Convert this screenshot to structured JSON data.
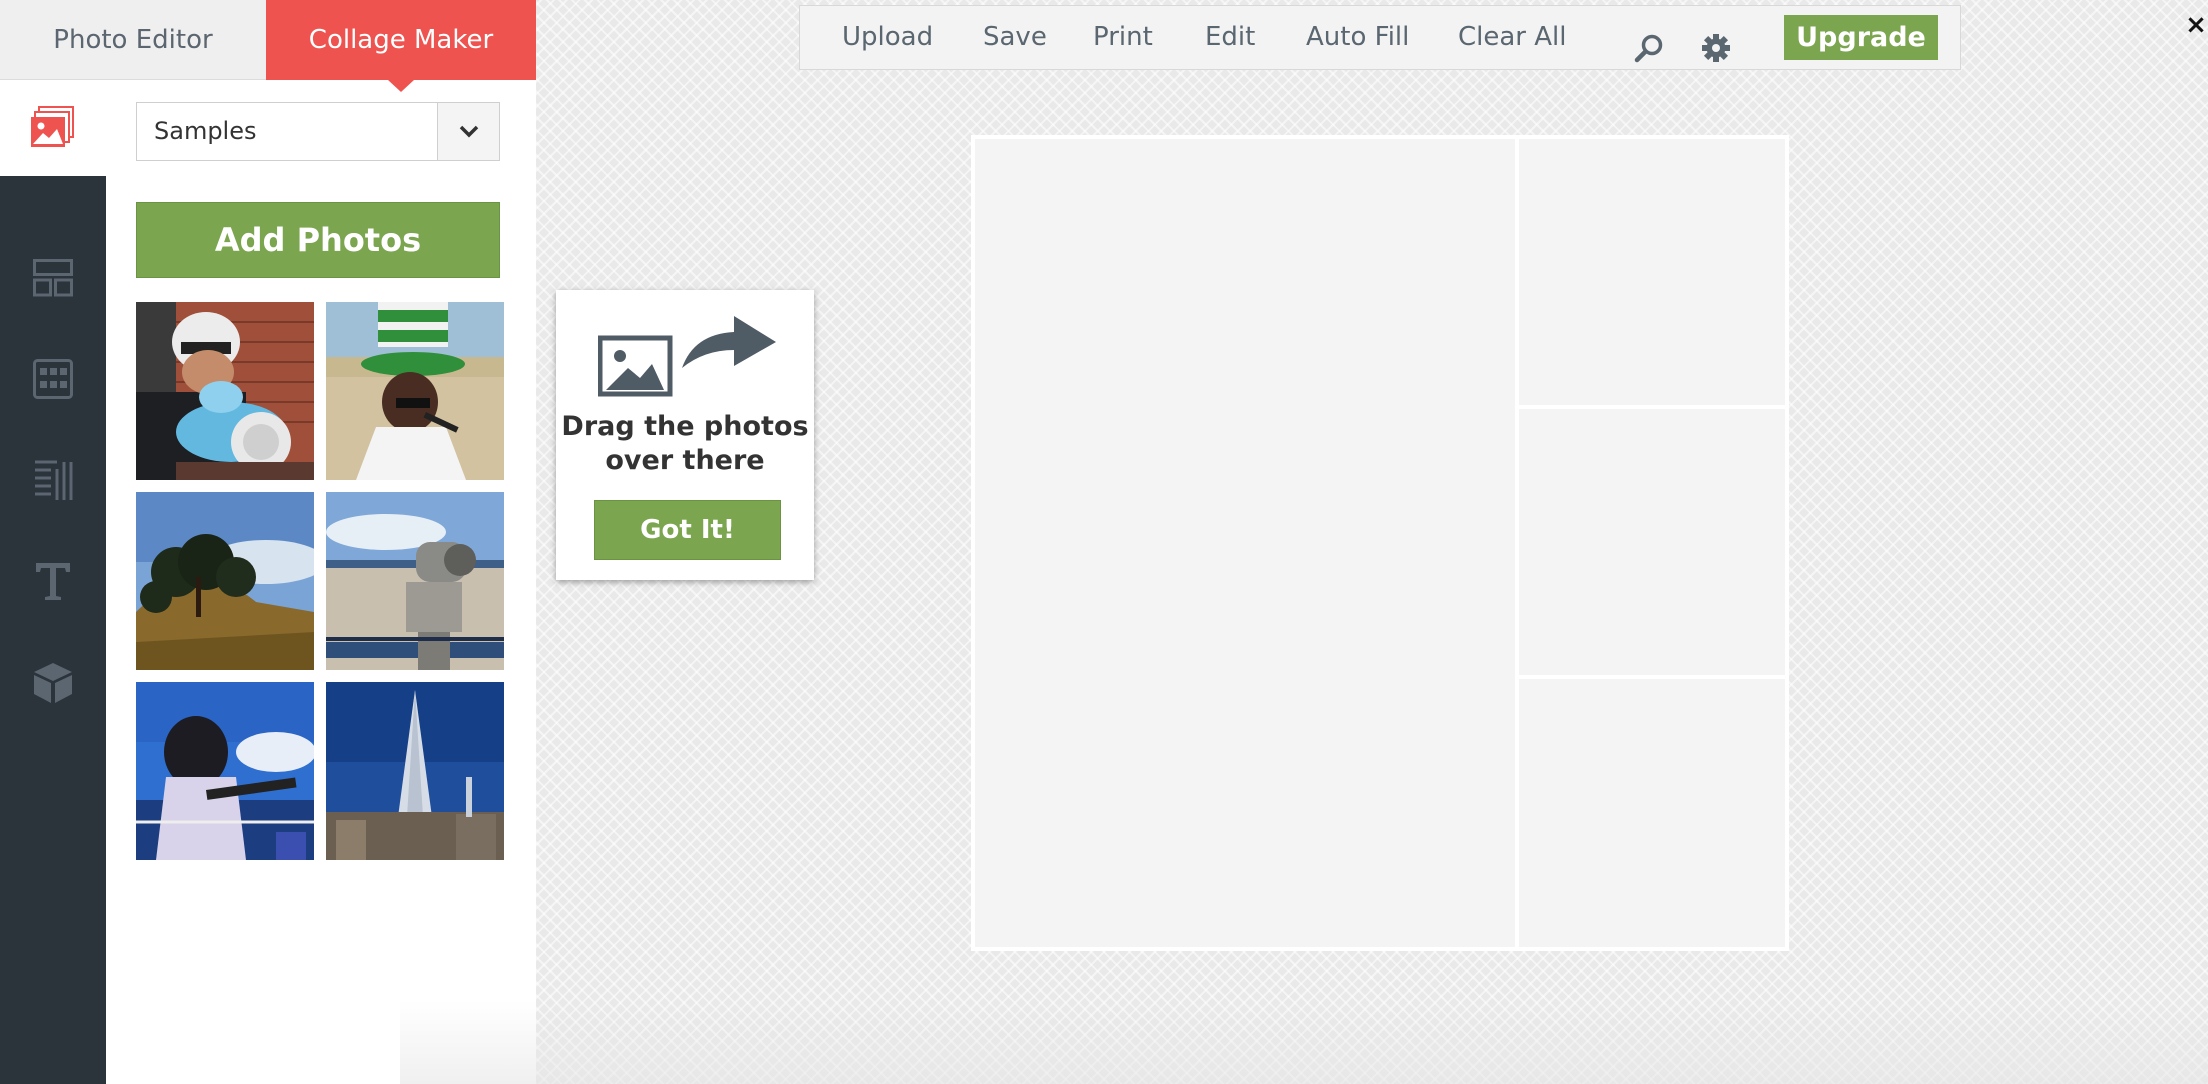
{
  "tabs": {
    "photo_editor": "Photo Editor",
    "collage_maker": "Collage Maker"
  },
  "sidebar": {
    "rail_icons": [
      "photos-icon",
      "layout-icon",
      "grid-icon",
      "backgrounds-icon",
      "text-icon",
      "stickers-icon"
    ],
    "active_rail_item": "photos",
    "source_select": {
      "selected": "Samples"
    },
    "add_photos_label": "Add Photos",
    "thumbnails": [
      "sample-photo-1",
      "sample-photo-2",
      "sample-photo-3",
      "sample-photo-4",
      "sample-photo-5",
      "sample-photo-6"
    ]
  },
  "toolbar": {
    "upload": "Upload",
    "save": "Save",
    "print": "Print",
    "edit": "Edit",
    "auto_fill": "Auto Fill",
    "clear_all": "Clear All",
    "search_icon": "search-icon",
    "settings_icon": "gear-icon",
    "upgrade": "Upgrade"
  },
  "close": "×",
  "hint": {
    "line1": "Drag the photos",
    "line2": "over there",
    "button": "Got It!"
  },
  "colors": {
    "accent_red": "#ef5350",
    "accent_green": "#7ba54e",
    "rail_dark": "#2b333b"
  }
}
